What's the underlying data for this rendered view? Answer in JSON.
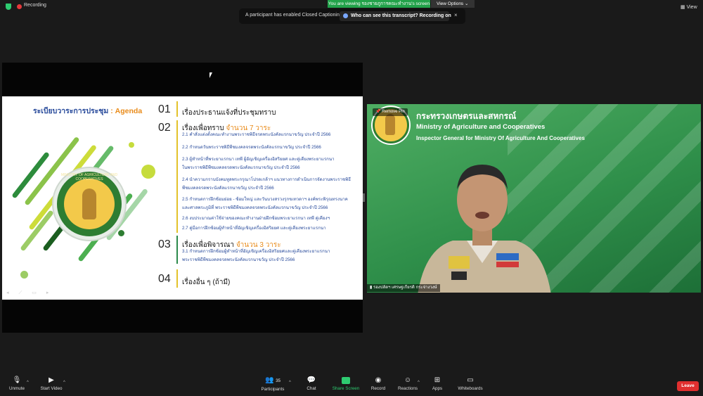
{
  "topbar": {
    "recording_label": "Recording",
    "viewing_banner": "You are viewing รองชายภูการคณะทำงาน's screen",
    "view_options_label": "View Options",
    "view_label": "View"
  },
  "toast": {
    "message": "A participant has enabled Closed Captioning",
    "link_label": "Who can see this transcript? Recording on",
    "close_label": "×"
  },
  "slide": {
    "title_th": "ระเบียบวาระการประชุม",
    "title_sep": " : ",
    "title_en": "Agenda",
    "seal_text": "MINISTRY OF AGRICULTURE AND COOPERATIVES",
    "agenda": [
      {
        "num": "01",
        "heading": "เรื่องประธานแจ้งที่ประชุมทราบ",
        "count": ""
      },
      {
        "num": "02",
        "heading": "เรื่องเพื่อทราบ ",
        "count": "จำนวน 7 วาระ"
      },
      {
        "num": "03",
        "heading": "เรื่องเพื่อพิจารณา ",
        "count": "จำนวน 3 วาระ"
      },
      {
        "num": "04",
        "heading": "เรื่องอื่น ๆ (ถ้ามี)",
        "count": ""
      }
    ],
    "items_02": [
      "2.1 คำสั่งแต่งตั้งคณะทำงานพระราชพิธีจรดพระนังคัลแรกนาขวัญ  ประจำปี 2566",
      "2.2 กำหนดวันพระราชพิธีพืชมงคลจรดพระนังคัลแรกนาขวัญ  ประจำปี 2566",
      "2.3 ผู้ทำหน้าที่พระยาแรกนา  เทพี ผู้อัญเชิญเครื่องอิสริยยศ  และคู่เคียงพระยาแรกนา",
      "      ในพระราชพิธีพืชมงคลจรดพระนังคัลแรกนาขวัญ  ประจำปี 2566",
      "2.4 นำความกราบบังคมทูลพระกรุณาโปรดเกล้าฯ  แนวทางการดำเนินการจัดงานพระราชพิธี",
      "      พืชมงคลจรดพระนังคัลแรกนาขวัญ  ประจำปี 2566",
      "2.5 กำหนดการฝึกซ้อมย่อย  - ซ้อมใหญ่  และวันบวงสรวงรุกขเทวดาฯ  องค์พระพิรุณทรงนาค",
      "      และศาลพระภูมิที่ พระราชพิธีพืชมงคลจรดพระนังคัลแรกนาขวัญ  ประจำปี 2566",
      "2.6 งบประมาณค่าใช้จ่ายของคณะทำงานฝ่ายฝึกซ้อมพระยาแรกนา  เทพี คู่เคียงฯ",
      "2.7 คู่มือการฝึกซ้อมผู้ทำหน้าที่อัญเชิญเครื่องอิสริยยศ  และคู่เคียงพระยาแรกนา"
    ],
    "items_03": [
      "3.1 กำหนดการฝึกซ้อมผู้ทำหน้าที่อัญเชิญเครื่องอิสริยยศและคู่เคียงพระยาแรกนา",
      "      พระราชพิธีพืชมงคลจรดพระนังคัลแรกนาขวัญ  ประจำปี 2566"
    ]
  },
  "video": {
    "remove_pin_label": "Remove Pin",
    "org_th": "กระทรวงเกษตรและสหกรณ์",
    "org_en": "Ministry of Agriculture and Cooperatives",
    "org_sub": "Inspector General for Ministry Of Agriculture And Cooperatives",
    "participant_name": "รองปลัดฯ เศรษฐเกียรติ กระจ่างวงษ์"
  },
  "toolbar": {
    "unmute": "Unmute",
    "start_video": "Start Video",
    "participants": "Participants",
    "participants_count": "35",
    "chat": "Chat",
    "share_screen": "Share Screen",
    "record": "Record",
    "reactions": "Reactions",
    "apps": "Apps",
    "whiteboards": "Whiteboards",
    "leave": "Leave"
  },
  "colors": {
    "share_green": "#2ecc71",
    "leave_red": "#e02f2f",
    "agenda_orange": "#e98b1a",
    "agenda_blue": "#2a4c9c",
    "tile_green": "#2f8f4a"
  }
}
